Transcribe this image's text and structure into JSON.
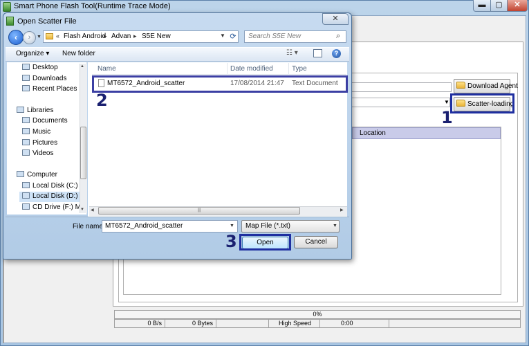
{
  "main_window": {
    "title": "Smart Phone Flash Tool(Runtime Trace Mode)",
    "close_label": "✕",
    "min_label": "▬",
    "max_label": "▢"
  },
  "main": {
    "download_agent_label": "Download Agent",
    "scatter_loading_label": "Scatter-loading",
    "table_location_header": "Location",
    "progress_text": "0%",
    "status": {
      "speed": "0 B/s",
      "bytes": "0 Bytes",
      "mode": "High Speed",
      "time": "0:00"
    }
  },
  "dialog": {
    "title": "Open Scatter File",
    "close_label": "✕",
    "breadcrumb": [
      "Flash Android",
      "Advan",
      "S5E New"
    ],
    "search_placeholder": "Search S5E New",
    "toolbar": {
      "organize": "Organize ▾",
      "new_folder": "New folder",
      "view": "☷ ▾"
    },
    "nav": {
      "favorites": [
        "Desktop",
        "Downloads",
        "Recent Places"
      ],
      "libraries_label": "Libraries",
      "libraries": [
        "Documents",
        "Music",
        "Pictures",
        "Videos"
      ],
      "computer_label": "Computer",
      "drives": [
        "Local Disk (C:)",
        "Local Disk (D:)",
        "CD Drive (F:) Mo"
      ]
    },
    "columns": {
      "name": "Name",
      "date": "Date modified",
      "type": "Type"
    },
    "files": [
      {
        "name": "MT6572_Android_scatter",
        "date": "17/08/2014 21:47",
        "type": "Text Document"
      }
    ],
    "filename_label": "File name:",
    "filename_value": "MT6572_Android_scatter",
    "filter_value": "Map File (*.txt)",
    "open_label": "Open",
    "cancel_label": "Cancel",
    "scroll_grip": "|||"
  },
  "annotations": {
    "marker_1": "1",
    "marker_2": "2",
    "marker_3": "3",
    "highlight_color": "#1f2fa0"
  }
}
